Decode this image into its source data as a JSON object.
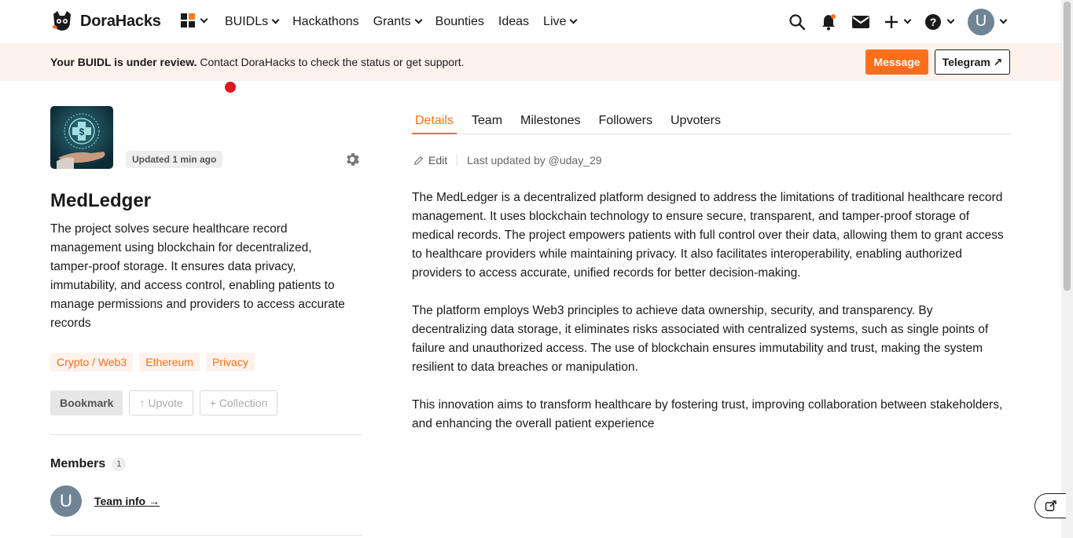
{
  "nav": {
    "brand": "DoraHacks",
    "links": [
      {
        "label": "BUIDLs",
        "dropdown": true
      },
      {
        "label": "Hackathons",
        "dropdown": false
      },
      {
        "label": "Grants",
        "dropdown": true
      },
      {
        "label": "Bounties",
        "dropdown": false
      },
      {
        "label": "Ideas",
        "dropdown": false
      },
      {
        "label": "Live",
        "dropdown": true
      }
    ],
    "user_initial": "U",
    "brand_color": "#ff6f1a"
  },
  "banner": {
    "bold": "Your BUIDL is under review.",
    "text": " Contact DoraHacks to check the status or get support.",
    "message_label": "Message",
    "telegram_label": "Telegram ↗"
  },
  "project": {
    "updated": "Updated 1 min ago",
    "title": "MedLedger",
    "description": "The project solves secure healthcare record management using blockchain for decentralized, tamper-proof storage. It ensures data privacy, immutability, and access control, enabling patients to manage permissions and providers to access accurate records",
    "tags": [
      "Crypto / Web3",
      "Ethereum",
      "Privacy"
    ],
    "bookmark_label": "Bookmark",
    "upvote_label": "↑ Upvote",
    "collection_label": "+ Collection"
  },
  "members": {
    "heading": "Members",
    "count": "1",
    "avatar_initial": "U",
    "team_info_label": "Team info →"
  },
  "tabs": [
    {
      "label": "Details",
      "active": true
    },
    {
      "label": "Team",
      "active": false
    },
    {
      "label": "Milestones",
      "active": false
    },
    {
      "label": "Followers",
      "active": false
    },
    {
      "label": "Upvoters",
      "active": false
    }
  ],
  "details": {
    "edit_label": "Edit",
    "last_updated": "Last updated by @uday_29",
    "paragraphs": [
      "The MedLedger is a decentralized platform designed to address the limitations of traditional healthcare record management. It uses blockchain technology to ensure secure, transparent, and tamper-proof storage of medical records. The project empowers patients with full control over their data, allowing them to grant access to healthcare providers while maintaining privacy. It also facilitates interoperability, enabling authorized providers to access accurate, unified records for better decision-making.",
      "The platform employs Web3 principles to achieve data ownership, security, and transparency. By decentralizing data storage, it eliminates risks associated with centralized systems, such as single points of failure and unauthorized access. The use of blockchain ensures immutability and trust, making the system resilient to data breaches or manipulation.",
      "This innovation aims to transform healthcare by fostering trust, improving collaboration between stakeholders, and enhancing the overall patient experience"
    ]
  }
}
